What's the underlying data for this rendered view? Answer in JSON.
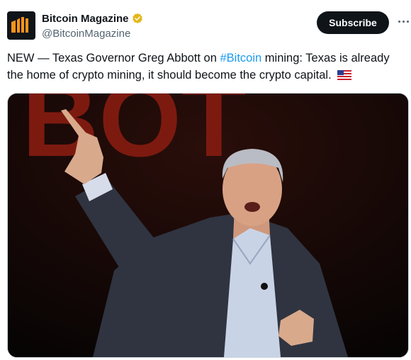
{
  "account": {
    "display_name": "Bitcoin Magazine",
    "handle": "@BitcoinMagazine",
    "avatar_icon": "bitcoin-magazine-logo",
    "verified_icon": "gold-verified-badge-icon",
    "verified_color": "#e2b719"
  },
  "actions": {
    "subscribe_label": "Subscribe",
    "more_icon": "more-dots-icon"
  },
  "tweet": {
    "text_before": "NEW — Texas Governor Greg Abbott on ",
    "hashtag": "#Bitcoin",
    "text_after": " mining: Texas is already the home of crypto mining, it should become the crypto capital.",
    "emoji": "us-flag-icon"
  },
  "media": {
    "background_text": "BOT",
    "background_color": "#0b0707",
    "lettering_color": "#7d1a10"
  }
}
